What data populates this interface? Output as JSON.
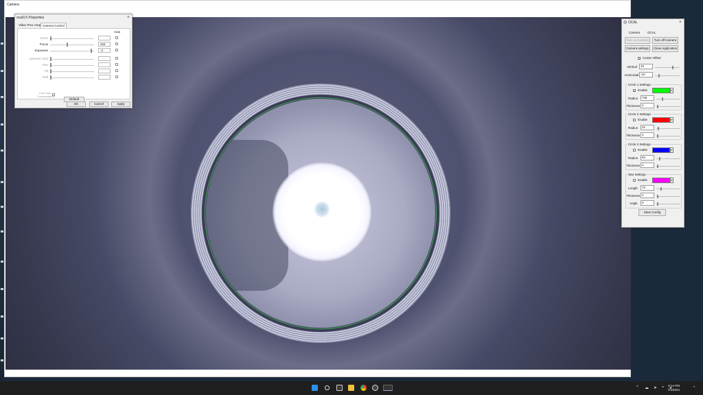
{
  "camera_window": {
    "title": "Camera"
  },
  "properties": {
    "title": "ocal3.5 Properties",
    "tabs": [
      "Video Proc Amp",
      "Camera Control"
    ],
    "auto_header": "Auto",
    "rows": [
      {
        "label": "Zoom",
        "value": "",
        "level": 0.0,
        "enabled": false
      },
      {
        "label": "Focus",
        "value": "404",
        "level": 0.38,
        "enabled": true
      },
      {
        "label": "Exposure",
        "value": "-2",
        "level": 0.95,
        "enabled": true
      },
      {
        "label": "Aperture (Iris)",
        "value": "",
        "level": 0.0,
        "enabled": false
      },
      {
        "label": "Pan",
        "value": "",
        "level": 0.0,
        "enabled": false
      },
      {
        "label": "Tilt",
        "value": "",
        "level": 0.0,
        "enabled": false
      },
      {
        "label": "Roll",
        "value": "",
        "level": 0.0,
        "enabled": false
      }
    ],
    "low_light": "Low Light Compensation",
    "default_label": "Default",
    "ok_label": "OK",
    "cancel_label": "Cancel",
    "apply_label": "Apply"
  },
  "ocal": {
    "title": "OCAL",
    "camera_header": "Camera",
    "ocal_header": "OCAL",
    "turn_on": "Turn on Camera",
    "turn_off": "Turn off Camera",
    "camera_settings": "Camera settings",
    "close_app": "Close Application",
    "center_offset": "Center Offset",
    "vertical_label": "Vertical",
    "vertical_value": "10",
    "horizontal_label": "Horizontal",
    "horizontal_value": "-10",
    "enable_label": "Enable",
    "radius_label": "Radius",
    "thickness_label": "Thickness",
    "length_label": "Length",
    "angle_label": "Angle",
    "circle1": {
      "title": "Circle 1 Settings",
      "enabled": true,
      "color": "#00ff00",
      "radius": "746",
      "thickness": "1"
    },
    "circle2": {
      "title": "Circle 2 Settings",
      "enabled": false,
      "color": "#ff0000",
      "radius": "22",
      "thickness": "1"
    },
    "circle3": {
      "title": "Circle 3 Settings",
      "enabled": false,
      "color": "#0000ff",
      "radius": "64",
      "thickness": "1"
    },
    "star": {
      "title": "Star Settings",
      "enabled": false,
      "color": "#ff00ff",
      "length": "73",
      "thickness": "1",
      "angle": "0"
    },
    "save_config": "Save Config"
  },
  "taskbar": {
    "time": "8:14 PM",
    "date": "7/4/2024",
    "icons": [
      "windows-start-icon",
      "search-icon",
      "task-view-icon",
      "file-explorer-icon",
      "chrome-icon",
      "obs-icon",
      "camera-app-icon"
    ]
  }
}
